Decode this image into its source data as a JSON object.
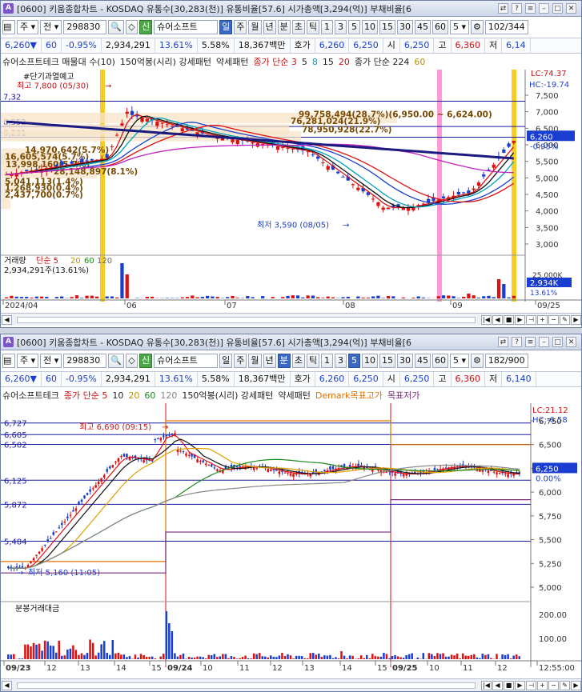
{
  "window_top": {
    "title": "[0600] 키움종합차트 - KOSDAQ 유통수[30,283(천)] 유통비율[57.6] 시가총액[3,294(억)] 부채비율[6",
    "toolbar": {
      "type": "주",
      "mode": "전",
      "code": "298830",
      "name": "슈어소프트",
      "periods": [
        "일",
        "주",
        "월",
        "년",
        "분",
        "초",
        "틱"
      ],
      "selected_period": "일",
      "intervals": [
        "1",
        "3",
        "5",
        "10",
        "15",
        "30",
        "45",
        "60"
      ],
      "interval_select": "5",
      "count": "102/344"
    },
    "quote": {
      "price": "6,260▼",
      "change": "60",
      "rate": "-0.95%",
      "volume": "2,934,291",
      "turnover": "13.61%",
      "ratio": "5.58%",
      "amount": "18,367백만",
      "hoga_label": "호가",
      "ask": "6,260",
      "bid": "6,250",
      "open_label": "시",
      "open": "6,250",
      "high_label": "고",
      "high": "6,360",
      "low_label": "저",
      "low": "6,14"
    },
    "legend": [
      {
        "text": "슈어소프트테크 매물대 수(10)",
        "color": "#222"
      },
      {
        "text": "150억봉(시리) 강세패턴",
        "color": "#222"
      },
      {
        "text": "약세패턴",
        "color": "#222"
      },
      {
        "text": "종가 단순 3",
        "color": "#d01010"
      },
      {
        "text": "5",
        "color": "#222"
      },
      {
        "text": "8",
        "color": "#00a0c0"
      },
      {
        "text": "15",
        "color": "#222"
      },
      {
        "text": "20",
        "color": "#d01010"
      },
      {
        "text": "종가 단순 224",
        "color": "#222"
      },
      {
        "text": "60",
        "color": "#c09000"
      }
    ],
    "lc": "LC:74.37",
    "hc": "HC:-19.74",
    "yaxis": [
      "7,500",
      "7,000",
      "6,500",
      "6,000",
      "5,500",
      "5,000",
      "4,500",
      "4,000",
      "3,500",
      "3,000"
    ],
    "price_label": "6,260",
    "rate_label": "-0.95%",
    "left_levels": [
      "6,552",
      "6,231",
      "7,32"
    ],
    "warning": "#단기과열예고",
    "high_annot": "최고 7,800 (05/30)",
    "low_annot": "최저 3,590 (08/05)",
    "volume_profile": [
      "99,758,494(28.7%)(6,950.00 ~ 6,624.00)",
      "76,281,024(21.9%)",
      "78,950,928(22.7%)",
      "14,970,642(5.7%)",
      "16,605,574(5.7%)",
      "13,998,160(5.7%)",
      "28,148,897(8.1%)",
      "5,041,113(1.4%)",
      "1,268,930(0.4%)",
      "2,437,700(0.7%)"
    ],
    "vol_legend": {
      "title": "거래량",
      "ma": "단순 5",
      "m20": "20",
      "m60": "60",
      "m120": "120",
      "value": "2,934,291주(13.61%)"
    },
    "vol_axis": {
      "top": "25,000K",
      "value": "2,934K",
      "pct": "13.61%"
    },
    "xaxis": [
      "2024/04",
      "06",
      "07",
      "08",
      "09",
      "09/25"
    ]
  },
  "window_bottom": {
    "title": "[0600] 키움종합차트 - KOSDAQ 유통수[30,283(천)] 유통비율[57.6] 시가총액[3,294(억)] 부채비율[6",
    "toolbar": {
      "type": "주",
      "mode": "전",
      "code": "298830",
      "name": "슈어소프트",
      "periods": [
        "일",
        "주",
        "월",
        "년",
        "분",
        "초",
        "틱"
      ],
      "selected_period": "분",
      "intervals": [
        "1",
        "3",
        "5",
        "10",
        "15",
        "30",
        "45",
        "60"
      ],
      "interval_select": "5",
      "count": "182/900"
    },
    "quote": {
      "price": "6,260▼",
      "change": "60",
      "rate": "-0.95%",
      "volume": "2,934,291",
      "turnover": "13.61%",
      "ratio": "5.58%",
      "amount": "18,367백만",
      "hoga_label": "호가",
      "ask": "6,260",
      "bid": "6,250",
      "open_label": "시",
      "open": "6,250",
      "high_label": "고",
      "high": "6,360",
      "low_label": "저",
      "low": "6,140"
    },
    "legend": [
      {
        "text": "슈어소프트테크",
        "color": "#222"
      },
      {
        "text": "종가 단순 5",
        "color": "#d01010"
      },
      {
        "text": "10",
        "color": "#222"
      },
      {
        "text": "20",
        "color": "#c09000"
      },
      {
        "text": "60",
        "color": "#1a8a1a"
      },
      {
        "text": "120",
        "color": "#888"
      },
      {
        "text": "150억봉(시리) 강세패턴",
        "color": "#222"
      },
      {
        "text": "약세패턴",
        "color": "#222"
      },
      {
        "text": "Demark목표고가",
        "color": "#e07000"
      },
      {
        "text": "목표저가",
        "color": "#7a2a7a"
      }
    ],
    "lc": "LC:21.12",
    "hc": "HC:-6.58",
    "yaxis": [
      "6,750",
      "6,500",
      "6,250",
      "6,000",
      "5,750",
      "5,500",
      "5,250",
      "5,000"
    ],
    "price_label": "6,250",
    "rate_label": "0.00%",
    "left_levels": [
      "6,727",
      "6,605",
      "6,502",
      "6,125",
      "5,872",
      "5,484"
    ],
    "high_annot": "최고 6,690 (09:15)",
    "low_annot": "최저 5,160 (11:05)",
    "vol_legend": {
      "title": "분봉거래대금"
    },
    "vol_axis": {
      "top": "200.00",
      "mid": "100.00"
    },
    "xaxis": [
      "09/23",
      "12",
      "13",
      "14",
      "15",
      "09/24",
      "10",
      "11",
      "12",
      "13",
      "14",
      "15",
      "09/25",
      "10",
      "11",
      "12",
      "12:55:00"
    ]
  }
}
